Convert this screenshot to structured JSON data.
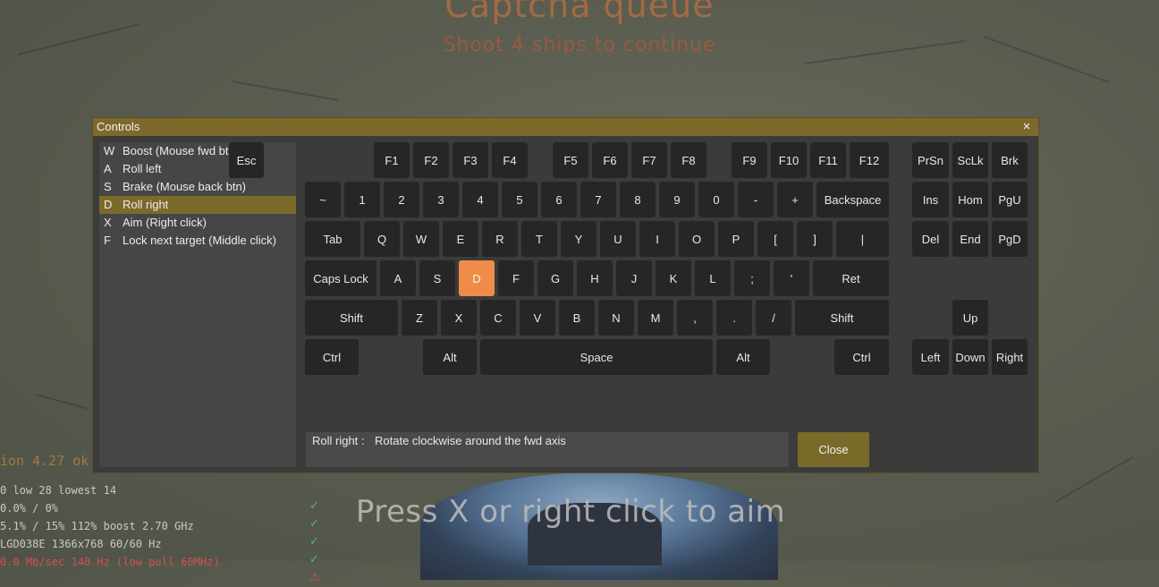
{
  "hud": {
    "title": "Captcha queue",
    "subtitle": "Shoot 4 ships to continue",
    "version": "ion 4.27 ok",
    "stats": [
      "0 low 28 lowest 14",
      "0.0% / 0%",
      "5.1% / 15% 112% boost 2.70 GHz",
      "LGD038E 1366x768 60/60 Hz",
      "0.0 Mb/sec 140 Hz (low pull 60MHz)"
    ],
    "checks": [
      "✓",
      "✓",
      "✓",
      "✓",
      "⚠"
    ],
    "aim_hint": "Press X or right click to aim"
  },
  "window": {
    "title": "Controls",
    "close_icon": "×",
    "bindings": [
      {
        "key": "W",
        "action": "Boost (Mouse fwd btn)",
        "selected": false
      },
      {
        "key": "A",
        "action": "Roll left",
        "selected": false
      },
      {
        "key": "S",
        "action": "Brake (Mouse back btn)",
        "selected": false
      },
      {
        "key": "D",
        "action": "Roll right",
        "selected": true
      },
      {
        "key": "X",
        "action": "Aim (Right click)",
        "selected": false
      },
      {
        "key": "F",
        "action": "Lock next target (Middle click)",
        "selected": false
      }
    ],
    "keyboard": {
      "function_row": [
        "Esc",
        "F1",
        "F2",
        "F3",
        "F4",
        "F5",
        "F6",
        "F7",
        "F8",
        "F9",
        "F10",
        "F11",
        "F12"
      ],
      "number_row": [
        "~",
        "1",
        "2",
        "3",
        "4",
        "5",
        "6",
        "7",
        "8",
        "9",
        "0",
        "-",
        "+",
        "Backspace"
      ],
      "tab_row": [
        "Tab",
        "Q",
        "W",
        "E",
        "R",
        "T",
        "Y",
        "U",
        "I",
        "O",
        "P",
        "[",
        "]",
        "|"
      ],
      "caps_row": [
        "Caps Lock",
        "A",
        "S",
        "D",
        "F",
        "G",
        "H",
        "J",
        "K",
        "L",
        ";",
        "'",
        "Ret"
      ],
      "shift_row": [
        "Shift",
        "Z",
        "X",
        "C",
        "V",
        "B",
        "N",
        "M",
        ",",
        ".",
        "/",
        "Shift"
      ],
      "bottom_row": [
        "Ctrl",
        "Alt",
        "Space",
        "Alt",
        "Ctrl"
      ],
      "nav_keys": [
        "PrSn",
        "ScLk",
        "Brk",
        "Ins",
        "Hom",
        "PgU",
        "Del",
        "End",
        "PgD"
      ],
      "arrow_keys": [
        "Up",
        "Left",
        "Down",
        "Right"
      ],
      "active_key": "D"
    },
    "description": {
      "label": "Roll right :",
      "text": "Rotate clockwise around the fwd axis"
    },
    "close_button": "Close",
    "colors": {
      "accent": "#7c6a2b",
      "active_key": "#f08c4a",
      "panel": "#3b3b3b",
      "key": "#262626"
    }
  }
}
